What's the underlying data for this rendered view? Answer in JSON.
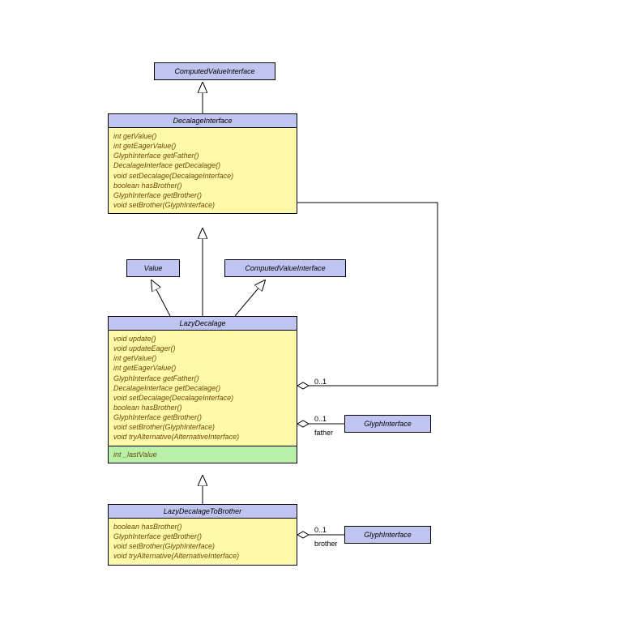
{
  "chart_data": {
    "type": "uml-class-diagram",
    "classes": [
      {
        "id": "ComputedValueInterface_top",
        "name": "ComputedValueInterface",
        "stereotype": null,
        "compartments": []
      },
      {
        "id": "DecalageInterface",
        "name": "DecalageInterface",
        "compartments": [
          {
            "kind": "operations",
            "items": [
              "int getValue()",
              "int getEagerValue()",
              "GlyphInterface getFather()",
              "DecalageInterface getDecalage()",
              "void setDecalage(DecalageInterface)",
              "boolean hasBrother()",
              "GlyphInterface getBrother()",
              "void setBrother(GlyphInterface)"
            ]
          }
        ]
      },
      {
        "id": "Value",
        "name": "Value",
        "compartments": []
      },
      {
        "id": "ComputedValueInterface_mid",
        "name": "ComputedValueInterface",
        "compartments": []
      },
      {
        "id": "LazyDecalage",
        "name": "LazyDecalage",
        "compartments": [
          {
            "kind": "operations",
            "items": [
              "void update()",
              "void updateEager()",
              "int getValue()",
              "int getEagerValue()",
              "GlyphInterface getFather()",
              "DecalageInterface getDecalage()",
              "void setDecalage(DecalageInterface)",
              "boolean hasBrother()",
              "GlyphInterface getBrother()",
              "void setBrother(GlyphInterface)",
              "void tryAlternative(AlternativeInterface)"
            ]
          },
          {
            "kind": "attributes",
            "items": [
              "int _lastValue"
            ]
          }
        ]
      },
      {
        "id": "LazyDecalageToBrother",
        "name": "LazyDecalageToBrother",
        "compartments": [
          {
            "kind": "operations",
            "items": [
              "boolean hasBrother()",
              "GlyphInterface getBrother()",
              "void setBrother(GlyphInterface)",
              "void tryAlternative(AlternativeInterface)"
            ]
          }
        ]
      },
      {
        "id": "GlyphInterface_a",
        "name": "GlyphInterface",
        "compartments": []
      },
      {
        "id": "GlyphInterface_b",
        "name": "GlyphInterface",
        "compartments": []
      }
    ],
    "relationships": [
      {
        "from": "DecalageInterface",
        "to": "ComputedValueInterface_top",
        "type": "generalization"
      },
      {
        "from": "LazyDecalage",
        "to": "DecalageInterface",
        "type": "generalization"
      },
      {
        "from": "LazyDecalage",
        "to": "Value",
        "type": "generalization"
      },
      {
        "from": "LazyDecalage",
        "to": "ComputedValueInterface_mid",
        "type": "generalization"
      },
      {
        "from": "LazyDecalageToBrother",
        "to": "LazyDecalage",
        "type": "generalization"
      },
      {
        "from": "LazyDecalage",
        "to": "DecalageInterface",
        "type": "aggregation",
        "multiplicity": "0..1",
        "role": null
      },
      {
        "from": "LazyDecalage",
        "to": "GlyphInterface_a",
        "type": "aggregation",
        "multiplicity": "0..1",
        "role": "father"
      },
      {
        "from": "LazyDecalageToBrother",
        "to": "GlyphInterface_b",
        "type": "aggregation",
        "multiplicity": "0..1",
        "role": "brother"
      }
    ]
  },
  "labels": {
    "mult": "0..1",
    "father": "father",
    "brother": "brother"
  }
}
